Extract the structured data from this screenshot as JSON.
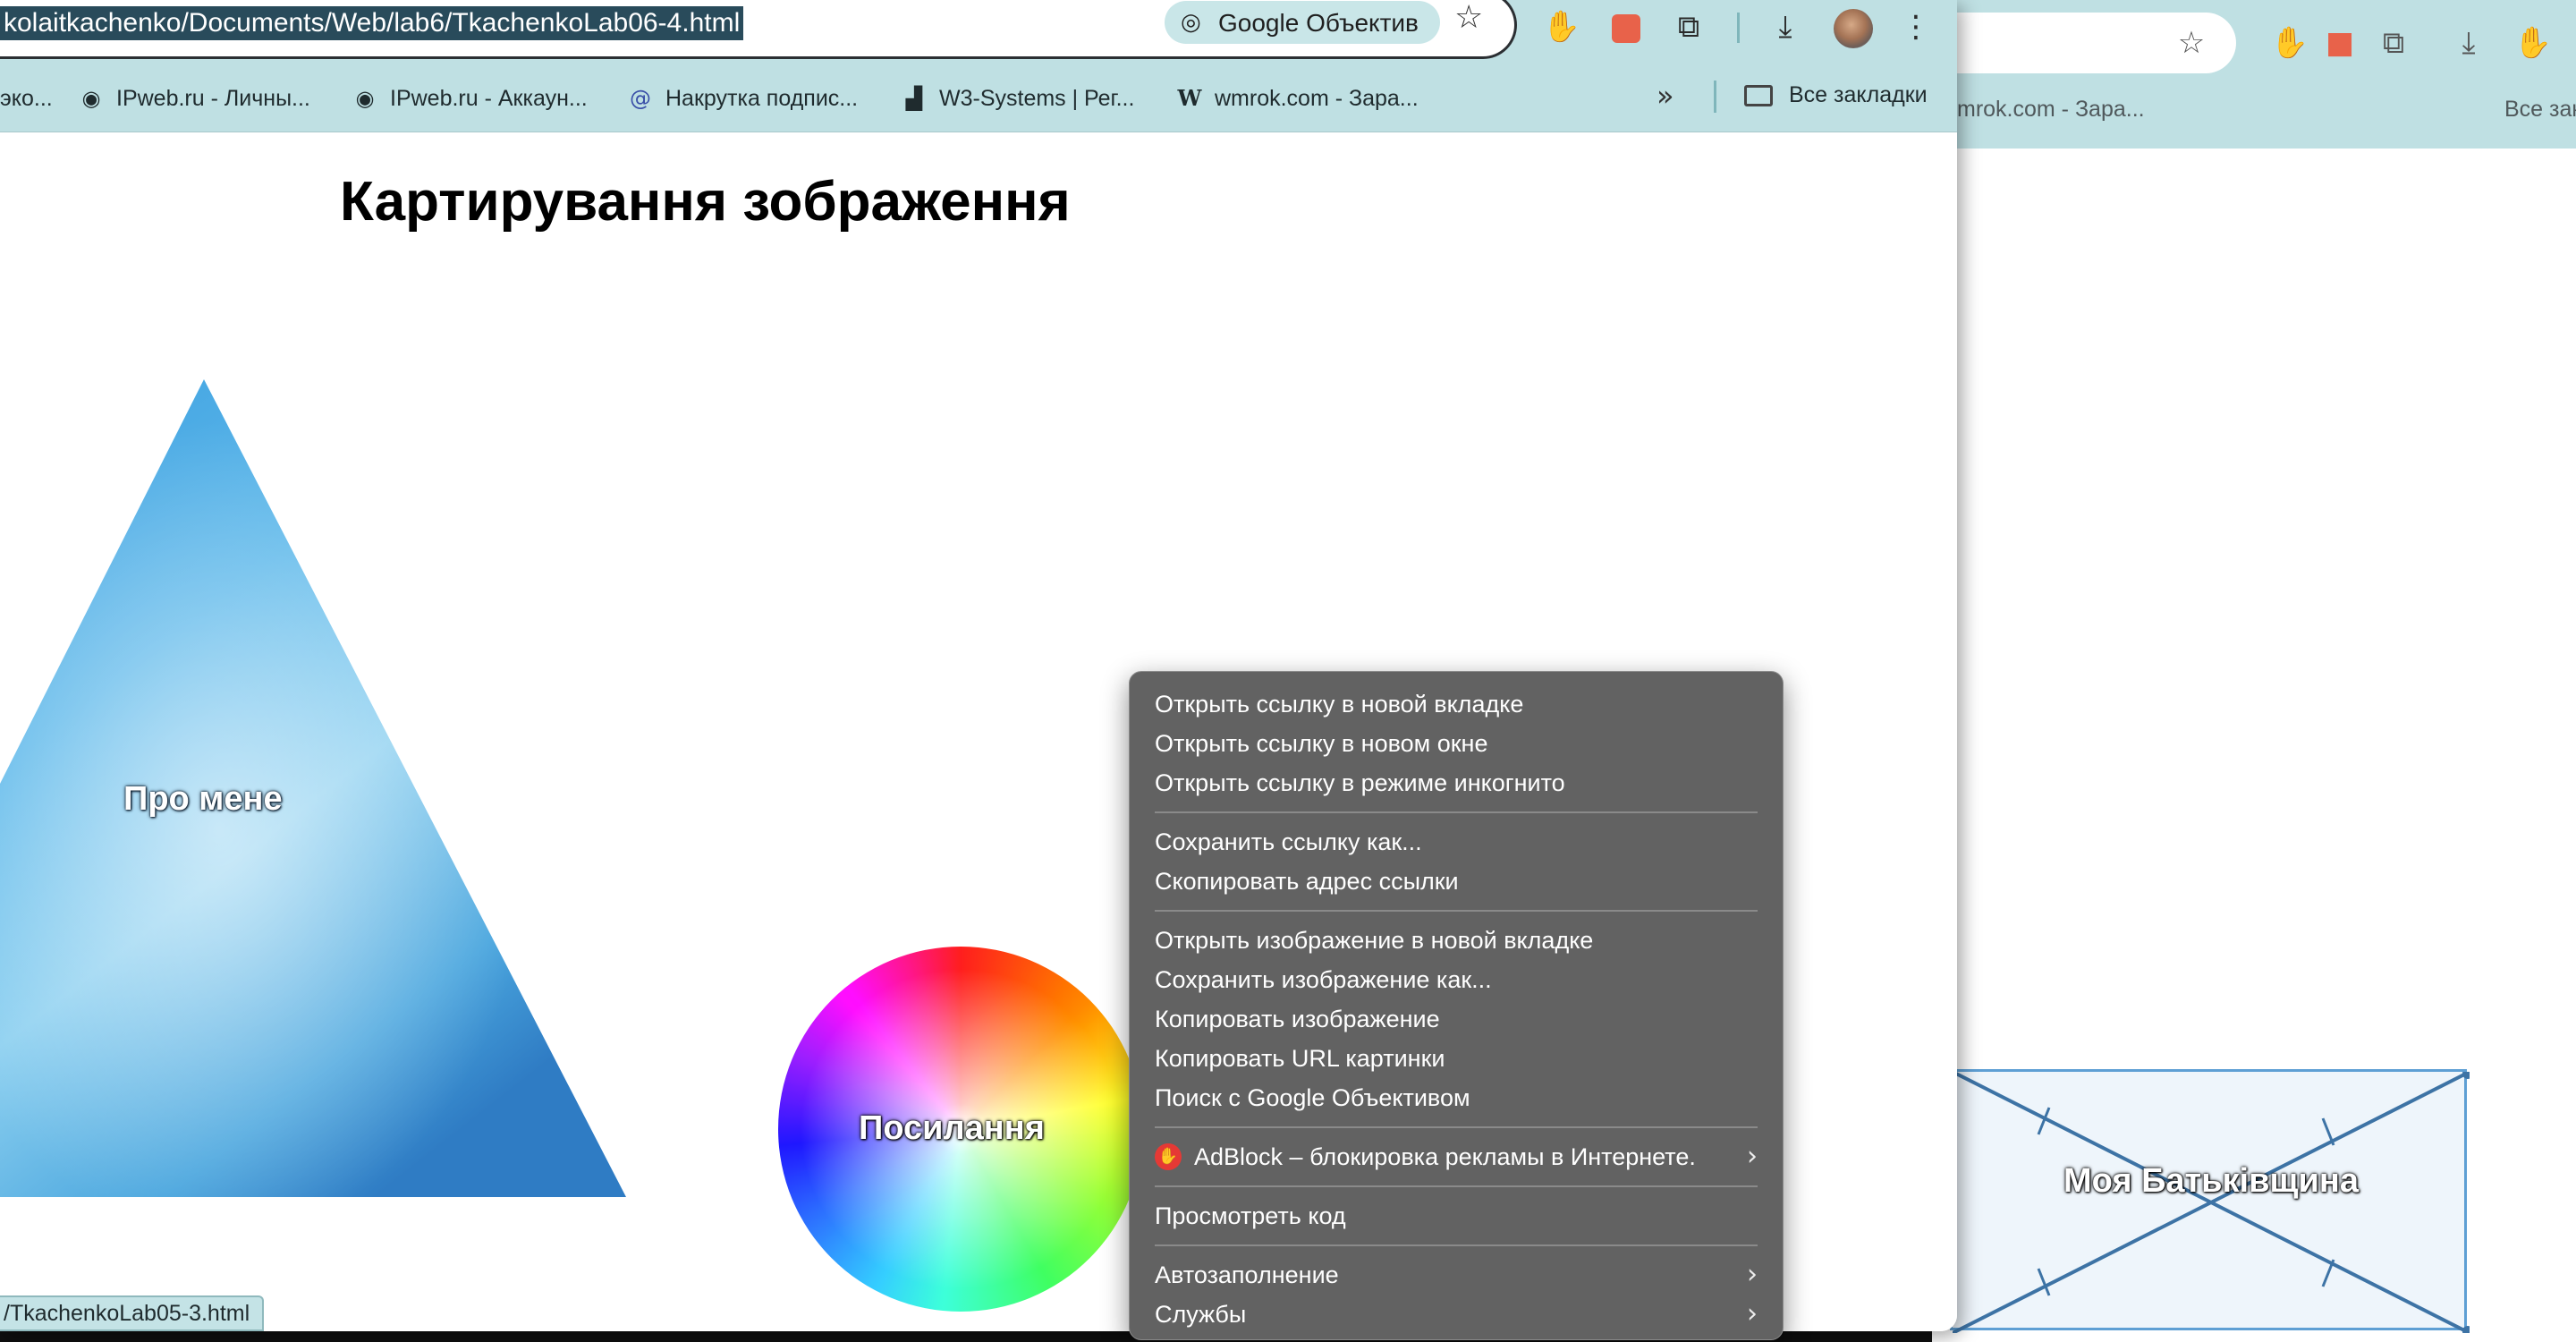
{
  "browser": {
    "url": "kolaitkachenko/Documents/Web/lab6/TkachenkoLab06-4.html",
    "lens_chip_label": "Google Объектив",
    "bookmarks": [
      {
        "label": "эко...",
        "icon": "globe-icon"
      },
      {
        "label": "IPweb.ru - Личны...",
        "icon": "globe-icon"
      },
      {
        "label": "IPweb.ru - Аккаун...",
        "icon": "globe-icon"
      },
      {
        "label": "Накрутка подпис...",
        "icon": "spiral-icon"
      },
      {
        "label": "W3-Systems | Рег...",
        "icon": "chart-icon"
      },
      {
        "label": "wmrok.com - Зара...",
        "icon": "w-logo-icon"
      }
    ],
    "all_bookmarks_label": "Все закладки",
    "status_url": "/TkachenkoLab05-3.html"
  },
  "background_window": {
    "bookmark": "mrok.com - Зара...",
    "all_bookmarks": "Все закл",
    "image_label": "Моя Батьківщина"
  },
  "page": {
    "title": "Картирування зображення",
    "triangle_label": "Про мене",
    "wheel_label": "Посилання"
  },
  "context_menu": {
    "groups": [
      [
        "Открыть ссылку в новой вкладке",
        "Открыть ссылку в новом окне",
        "Открыть ссылку в режиме инкогнито"
      ],
      [
        "Сохранить ссылку как...",
        "Скопировать адрес ссылки"
      ],
      [
        "Открыть изображение в новой вкладке",
        "Сохранить изображение как...",
        "Копировать изображение",
        "Копировать URL картинки",
        "Поиск с Google Объективом"
      ],
      [
        "AdBlock – блокировка рекламы в Интернете."
      ],
      [
        "Просмотреть код"
      ],
      [
        "Автозаполнение",
        "Службы"
      ]
    ]
  },
  "colors": {
    "toolbar": "#bfe0e3",
    "menu_bg": "#626262",
    "triangle_blue": "#3a9bd8"
  }
}
